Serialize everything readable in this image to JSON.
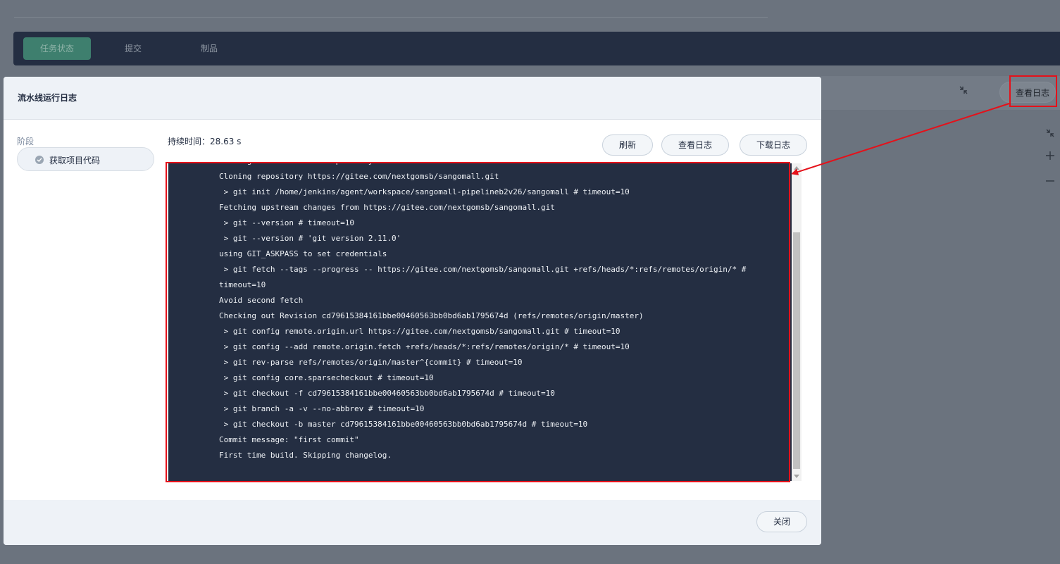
{
  "tabs": [
    {
      "label": "任务状态"
    },
    {
      "label": "提交"
    },
    {
      "label": "制品"
    }
  ],
  "right_panel": {
    "view_log_label": "查看日志"
  },
  "modal": {
    "title": "流水线运行日志",
    "stage_heading": "阶段",
    "stage_name": "获取项目代码",
    "duration_label": "持续时间：",
    "duration_value": "28.63 s",
    "refresh_label": "刷新",
    "view_log_label": "查看日志",
    "download_log_label": "下载日志",
    "close_label": "关闭"
  },
  "log_lines": [
    "Cloning the remote Git repository",
    "Cloning repository https://gitee.com/nextgomsb/sangomall.git",
    " > git init /home/jenkins/agent/workspace/sangomall-pipelineb2v26/sangomall # timeout=10",
    "Fetching upstream changes from https://gitee.com/nextgomsb/sangomall.git",
    " > git --version # timeout=10",
    " > git --version # 'git version 2.11.0'",
    "using GIT_ASKPASS to set credentials",
    " > git fetch --tags --progress -- https://gitee.com/nextgomsb/sangomall.git +refs/heads/*:refs/remotes/origin/* #",
    "timeout=10",
    "Avoid second fetch",
    "Checking out Revision cd79615384161bbe00460563bb0bd6ab1795674d (refs/remotes/origin/master)",
    " > git config remote.origin.url https://gitee.com/nextgomsb/sangomall.git # timeout=10",
    " > git config --add remote.origin.fetch +refs/heads/*:refs/remotes/origin/* # timeout=10",
    " > git rev-parse refs/remotes/origin/master^{commit} # timeout=10",
    " > git config core.sparsecheckout # timeout=10",
    " > git checkout -f cd79615384161bbe00460563bb0bd6ab1795674d # timeout=10",
    " > git branch -a -v --no-abbrev # timeout=10",
    " > git checkout -b master cd79615384161bbe00460563bb0bd6ab1795674d # timeout=10",
    "Commit message: \"first commit\"",
    "First time build. Skipping changelog."
  ],
  "colors": {
    "overlay": "#6b737e",
    "tabbar": "#242e42",
    "active_tab": "#3e7f6e",
    "log_background": "#242e42",
    "annotation": "#e5111a"
  },
  "icons": [
    "check-icon",
    "fullscreen-icon",
    "zoom-in-icon",
    "zoom-out-icon"
  ]
}
